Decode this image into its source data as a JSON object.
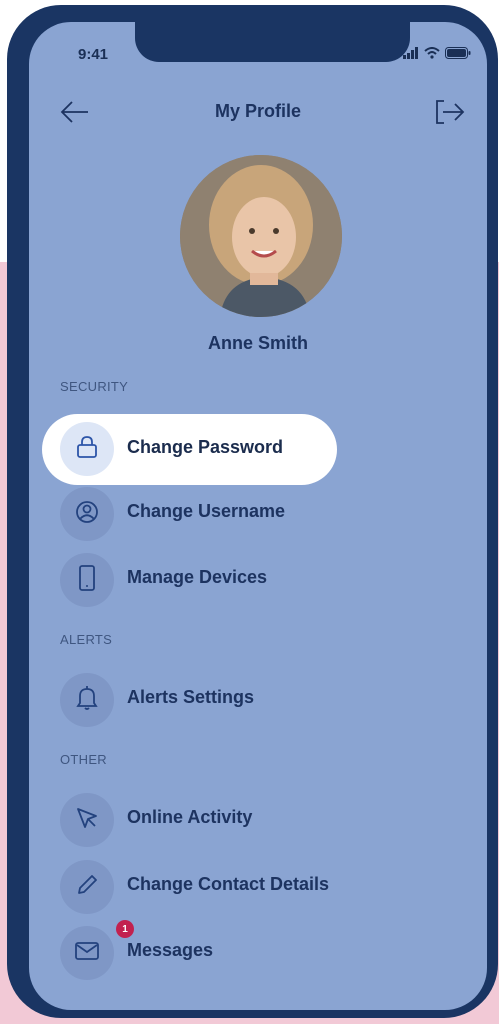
{
  "status_bar": {
    "time": "9:41"
  },
  "header": {
    "title": "My Profile",
    "back_icon": "arrow-left-icon",
    "logout_icon": "logout-icon"
  },
  "profile": {
    "name": "Anne Smith"
  },
  "sections": {
    "security": {
      "label": "SECURITY",
      "items": [
        {
          "label": "Change Password",
          "icon": "lock-icon"
        },
        {
          "label": "Change Username",
          "icon": "user-circle-icon"
        },
        {
          "label": "Manage Devices",
          "icon": "phone-icon"
        }
      ]
    },
    "alerts": {
      "label": "ALERTS",
      "items": [
        {
          "label": "Alerts Settings",
          "icon": "bell-icon"
        }
      ]
    },
    "other": {
      "label": "OTHER",
      "items": [
        {
          "label": "Online Activity",
          "icon": "cursor-icon"
        },
        {
          "label": "Change Contact Details",
          "icon": "pencil-icon"
        },
        {
          "label": "Messages",
          "icon": "envelope-icon",
          "badge": "1"
        }
      ]
    }
  },
  "colors": {
    "frame": "#1a3563",
    "screen": "#8aa4d2",
    "text": "#1d3360",
    "badge": "#c2214f",
    "backdrop": "#f2c9d6"
  }
}
